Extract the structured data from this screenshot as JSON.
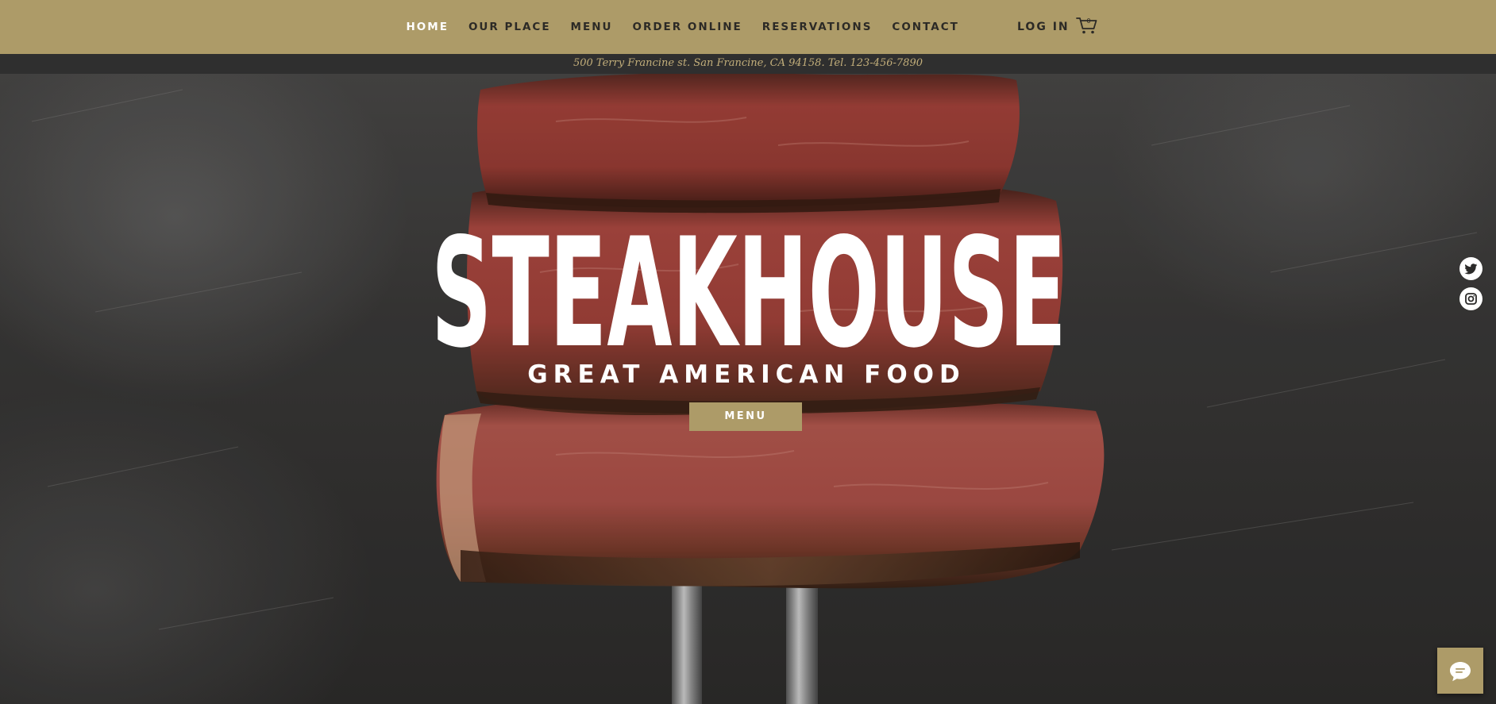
{
  "nav": {
    "items": [
      {
        "label": "HOME",
        "active": true
      },
      {
        "label": "OUR PLACE",
        "active": false
      },
      {
        "label": "MENU",
        "active": false
      },
      {
        "label": "ORDER ONLINE",
        "active": false
      },
      {
        "label": "RESERVATIONS",
        "active": false
      },
      {
        "label": "CONTACT",
        "active": false
      }
    ],
    "login_label": "LOG IN",
    "cart": {
      "icon": "cart-icon",
      "count": "0"
    }
  },
  "info_bar": {
    "text": "500 Terry Francine st.  San Francine, CA 94158.  Tel. 123-456-7890"
  },
  "hero": {
    "title": "STEAKHOUSE",
    "tagline": "GREAT AMERICAN FOOD",
    "menu_button_label": "MENU",
    "image": "steak-on-fork-image"
  },
  "social": [
    {
      "name": "Twitter",
      "icon": "twitter-icon"
    },
    {
      "name": "Instagram",
      "icon": "instagram-icon"
    }
  ],
  "chat": {
    "icon": "chat-bubble-icon"
  },
  "colors": {
    "accent": "#ad9b68",
    "info_bar_bg": "#2f2f2f",
    "info_text": "#c2ae7a",
    "nav_text": "#2c2a26",
    "nav_active": "#ffffff"
  }
}
